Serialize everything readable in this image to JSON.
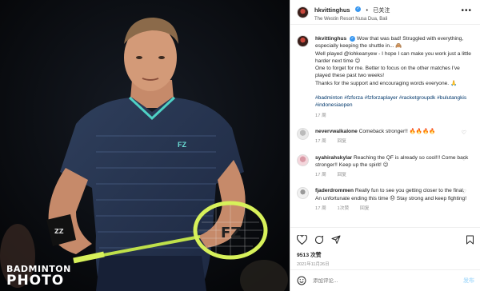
{
  "photo": {
    "watermark_line1": "BADMINTON",
    "watermark_line2": "PHOTO",
    "shirt_logo": "FZ"
  },
  "header": {
    "username": "hkvittinghus",
    "dot": "•",
    "follow_label": "已关注",
    "location": "The Westin Resort Nusa Dua, Bali",
    "more_icon": "more-horizontal-icon"
  },
  "caption": {
    "username": "hkvittinghus",
    "lines": [
      "Wow that was bad! Struggled with everything, especially keeping the shuttle in... 🙈",
      "Well played @lohkeanyew - I hope I can make you work just a little harder next time 😉",
      "One to forget for me. Better to focus on the other matches I've played these past two weeks!",
      "Thanks for the support and encouraging words everyone. 🙏"
    ],
    "hashtags": "#badminton #fzforza #fzforzaplayer #racketgroupdk #bulutangkis #indonesiaopen",
    "age": "17 周"
  },
  "comments": [
    {
      "username": "nevervwalkalone",
      "text": "Comeback stronger!! 🔥🔥🔥🔥",
      "age": "17 周",
      "likes": "",
      "reply": "回复"
    },
    {
      "username": "syahirahskylar",
      "text": "Reaching the QF is already so cool!!! Come back stronger!! Keep up the spirit! 😉",
      "age": "17 周",
      "likes": "",
      "reply": "回复"
    },
    {
      "username": "fjaderdrommen",
      "text": "Really fun to see you getting closer to the final. An unfortunate ending this time 😞 Stay strong and keep fighting!",
      "age": "17 周",
      "likes": "1次赞",
      "reply": "回复"
    }
  ],
  "actions": {
    "likes": "9513 次赞",
    "date": "2021年11月26日"
  },
  "add_comment": {
    "placeholder": "添加评论...",
    "post_label": "发布"
  },
  "colors": {
    "link": "#00376b",
    "verified": "#3897f0",
    "post_disabled": "#b2dffc"
  }
}
